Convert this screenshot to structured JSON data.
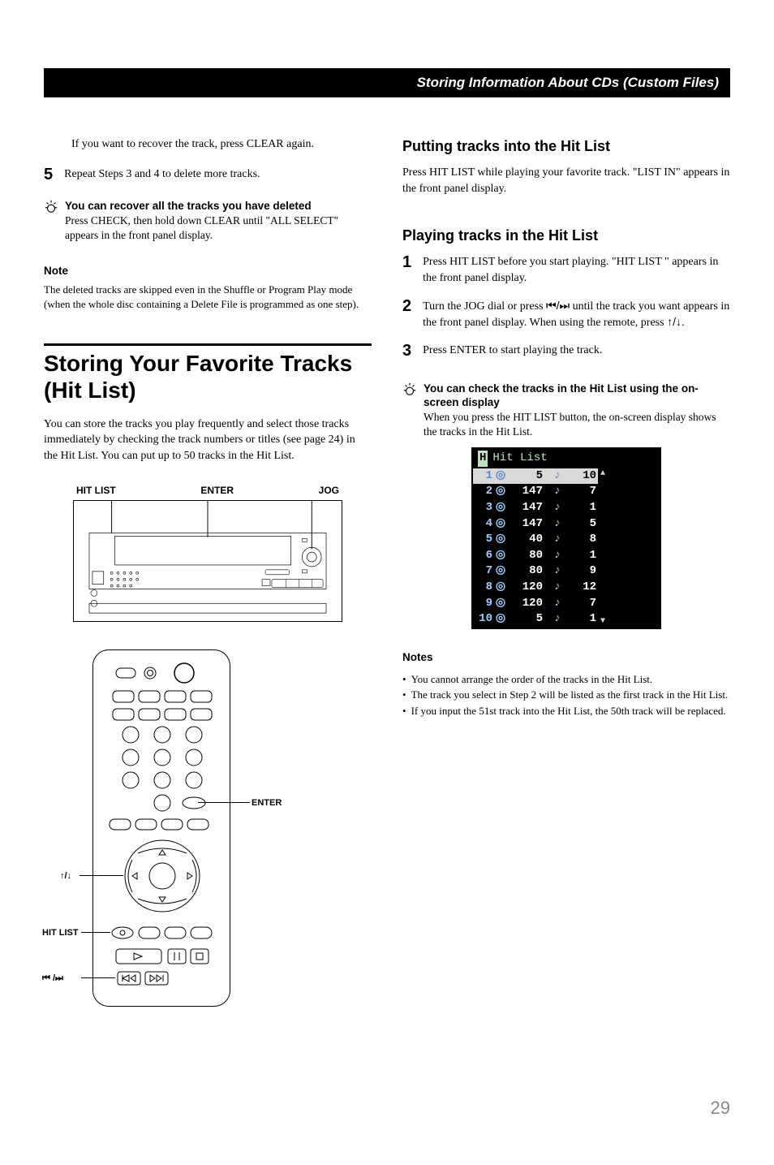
{
  "header": {
    "title": "Storing Information About CDs (Custom Files)"
  },
  "left": {
    "recover_para": "If you want to recover the track, press CLEAR again.",
    "step5_num": "5",
    "step5_text": "Repeat Steps 3 and 4 to delete more tracks.",
    "tip_title": "You can recover all the tracks you have deleted",
    "tip_body": "Press CHECK, then hold down CLEAR until \"ALL SELECT\" appears in the front panel display.",
    "note_title": "Note",
    "note_body": "The deleted tracks are skipped even in the Shuffle or Program Play mode (when the whole disc containing a Delete File is programmed as one step).",
    "section_title": "Storing Your Favorite Tracks (Hit List)",
    "section_intro": "You can store the tracks you play frequently and select those tracks immediately by checking the track numbers or titles (see page 24) in the Hit List. You can put up to 50 tracks in the Hit List.",
    "panel_labels": {
      "a": "HIT LIST",
      "b": "ENTER",
      "c": "JOG"
    },
    "remote_labels": {
      "enter": "ENTER",
      "up_down": "↑/↓",
      "hit_list": "HIT LIST",
      "prev_next": "⏮ /⏭"
    }
  },
  "right": {
    "putting": {
      "title": "Putting tracks into the Hit List",
      "body": "Press HIT LIST while playing your favorite track. \"LIST IN\" appears in the front panel display."
    },
    "playing": {
      "title": "Playing tracks in the Hit List",
      "step1_num": "1",
      "step1_text": "Press HIT LIST before you start playing. \"HIT LIST \" appears in the front panel display.",
      "step2_num": "2",
      "step2_text_a": "Turn the JOG dial or press ",
      "step2_text_b": " until the track you want appears in the front panel display. When using the remote, press ",
      "step2_text_c": ".",
      "step3_num": "3",
      "step3_text": "Press ENTER to start playing the track."
    },
    "tip_title": "You can check the tracks in the Hit List using the on-screen display",
    "tip_body": "When you press the HIT LIST button, the on-screen display shows the tracks in the Hit List.",
    "osd": {
      "header_icon": "H",
      "header_text": "Hit List",
      "rows": [
        {
          "idx": "1",
          "disc": "5",
          "track": "10",
          "hl": true
        },
        {
          "idx": "2",
          "disc": "147",
          "track": "7",
          "hl": false
        },
        {
          "idx": "3",
          "disc": "147",
          "track": "1",
          "hl": false
        },
        {
          "idx": "4",
          "disc": "147",
          "track": "5",
          "hl": false
        },
        {
          "idx": "5",
          "disc": "40",
          "track": "8",
          "hl": false
        },
        {
          "idx": "6",
          "disc": "80",
          "track": "1",
          "hl": false
        },
        {
          "idx": "7",
          "disc": "80",
          "track": "9",
          "hl": false
        },
        {
          "idx": "8",
          "disc": "120",
          "track": "12",
          "hl": false
        },
        {
          "idx": "9",
          "disc": "120",
          "track": "7",
          "hl": false
        },
        {
          "idx": "10",
          "disc": "5",
          "track": "1",
          "hl": false
        }
      ]
    },
    "notes_title": "Notes",
    "notes": [
      "You cannot arrange the order of the tracks in the Hit List.",
      "The track you select in Step 2 will be listed as the first track in the Hit List.",
      "If you input the 51st track into the Hit List, the 50th track will be replaced."
    ]
  },
  "page_number": "29"
}
